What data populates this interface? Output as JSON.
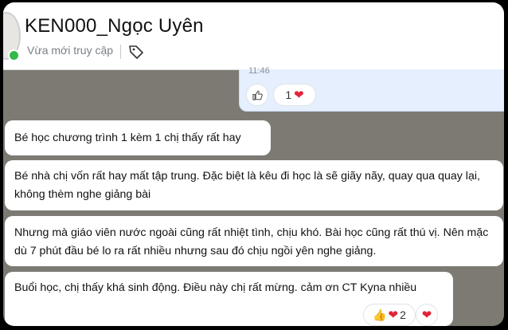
{
  "header": {
    "contact_name": "KEN000_Ngọc Uyên",
    "status": "Vừa mới truy cập"
  },
  "sent_message": {
    "time": "11:46",
    "reaction_count": "1"
  },
  "messages": [
    {
      "text": "Bé học chương trình 1 kèm 1 chị thấy rất hay"
    },
    {
      "text": "Bé nhà chị vốn rất hay mất tập trung. Đặc biệt là kêu đi học là sẽ giãy nãy, quay qua quay lại, không thèm nghe giảng bài"
    },
    {
      "text": "Nhưng mà giáo viên nước ngoài cũng rất nhiệt tình, chịu khó. Bài học cũng rất thú vị. Nên mặc dù 7 phút đầu bé lo ra rất nhiều nhưng sau đó chịu ngồi yên nghe giảng."
    },
    {
      "text": "Buổi học, chị thấy khá sinh động. Điều này chị rất mừng. cảm ơn CT Kyna nhiều",
      "reaction_count": "2"
    }
  ],
  "colors": {
    "chat_bg": "#7d7a73",
    "sent_bubble": "#e5effd",
    "online": "#33b94a",
    "heart": "#e0243a"
  },
  "icons": [
    "tag-icon",
    "like-icon",
    "heart-icon",
    "thumbs-up-icon"
  ]
}
